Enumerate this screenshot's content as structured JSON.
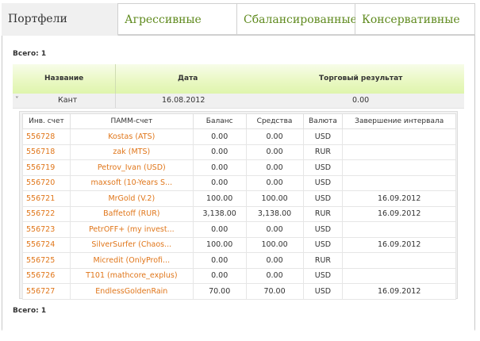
{
  "tabs": [
    {
      "label": "Портфели",
      "active": true
    },
    {
      "label": "Агрессивные",
      "active": false
    },
    {
      "label": "Сбалансированные",
      "active": false
    },
    {
      "label": "Консервативные",
      "active": false
    }
  ],
  "total_top": "Всего: 1",
  "total_bottom": "Всего: 1",
  "outer": {
    "headers": {
      "name": "Название",
      "date": "Дата",
      "result": "Торговый результат"
    },
    "row": {
      "expand_glyph": "˅",
      "name": "Кант",
      "date": "16.08.2012",
      "result": "0.00"
    }
  },
  "inner": {
    "headers": [
      "Инв. счет",
      "ПАММ-счет",
      "Баланс",
      "Средства",
      "Валюта",
      "Завершение интервала"
    ],
    "rows": [
      [
        "556728",
        "Kostas (ATS)",
        "0.00",
        "0.00",
        "USD",
        ""
      ],
      [
        "556718",
        "zak (MTS)",
        "0.00",
        "0.00",
        "RUR",
        ""
      ],
      [
        "556719",
        "Petrov_Ivan (USD)",
        "0.00",
        "0.00",
        "USD",
        ""
      ],
      [
        "556720",
        "maxsoft (10-Years S...",
        "0.00",
        "0.00",
        "USD",
        ""
      ],
      [
        "556721",
        "MrGold (V.2)",
        "100.00",
        "100.00",
        "USD",
        "16.09.2012"
      ],
      [
        "556722",
        "Baffetoff (RUR)",
        "3,138.00",
        "3,138.00",
        "RUR",
        "16.09.2012"
      ],
      [
        "556723",
        "PetrOFF+ (my invest...",
        "0.00",
        "0.00",
        "USD",
        ""
      ],
      [
        "556724",
        "SilverSurfer (Chaos...",
        "100.00",
        "100.00",
        "USD",
        "16.09.2012"
      ],
      [
        "556725",
        "Micredit (OnlyProfi...",
        "0.00",
        "0.00",
        "RUR",
        ""
      ],
      [
        "556726",
        "T101 (mathcore_explus)",
        "0.00",
        "0.00",
        "USD",
        ""
      ],
      [
        "556727",
        "EndlessGoldenRain",
        "70.00",
        "70.00",
        "USD",
        "16.09.2012"
      ]
    ]
  },
  "colors": {
    "link": "#e0761a",
    "tab_text": "#5f8a1e",
    "header_green": "#e6f7bb"
  }
}
